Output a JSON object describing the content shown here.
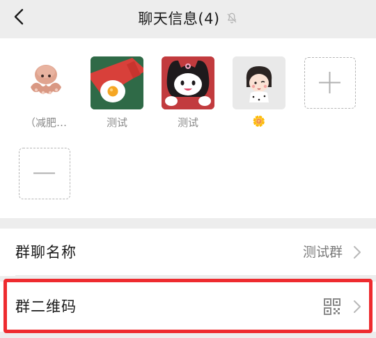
{
  "header": {
    "title": "聊天信息(4)",
    "back_icon": "back-chevron-icon",
    "mute_icon": "bell-mute-icon"
  },
  "members": [
    {
      "name": "（减肥…",
      "avatar": "octopus-plush-avatar"
    },
    {
      "name": "测试",
      "avatar": "fried-egg-avatar"
    },
    {
      "name": "测试",
      "avatar": "kuromi-avatar"
    },
    {
      "name": "🌼",
      "avatar": "cartoon-girl-avatar"
    }
  ],
  "actions": {
    "add_icon": "plus-icon",
    "remove_icon": "minus-icon"
  },
  "settings": {
    "group_name_label": "群聊名称",
    "group_name_value": "测试群",
    "qr_label": "群二维码",
    "qr_icon": "qr-code-icon"
  },
  "colors": {
    "background": "#ededed",
    "highlight": "#ee2b2f"
  }
}
